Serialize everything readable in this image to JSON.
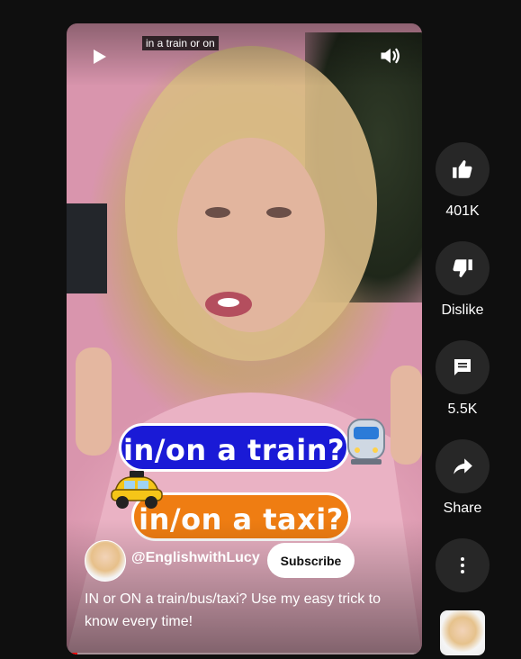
{
  "player": {
    "caption_text": "in a train or on",
    "sticker_train": "in/on a train?",
    "sticker_taxi": "in/on a taxi?",
    "channel": "@EnglishwithLucy",
    "subscribe_label": "Subscribe",
    "description": "IN or ON a train/bus/taxi? Use my easy trick to know every time!",
    "progress_fraction": 0.03,
    "play_icon": "play-icon",
    "volume_icon": "volume-icon"
  },
  "actions": {
    "like": {
      "icon": "thumb-up-icon",
      "label": "401K"
    },
    "dislike": {
      "icon": "thumb-down-icon",
      "label": "Dislike"
    },
    "comments": {
      "icon": "comment-icon",
      "label": "5.5K"
    },
    "share": {
      "icon": "share-icon",
      "label": "Share"
    },
    "more": {
      "icon": "more-vertical-icon"
    }
  },
  "colors": {
    "background": "#0f0f0f",
    "button_bg": "#272727",
    "train_sticker": "#1a1ad6",
    "taxi_sticker": "#ef7d12",
    "progress": "#ff0000"
  }
}
